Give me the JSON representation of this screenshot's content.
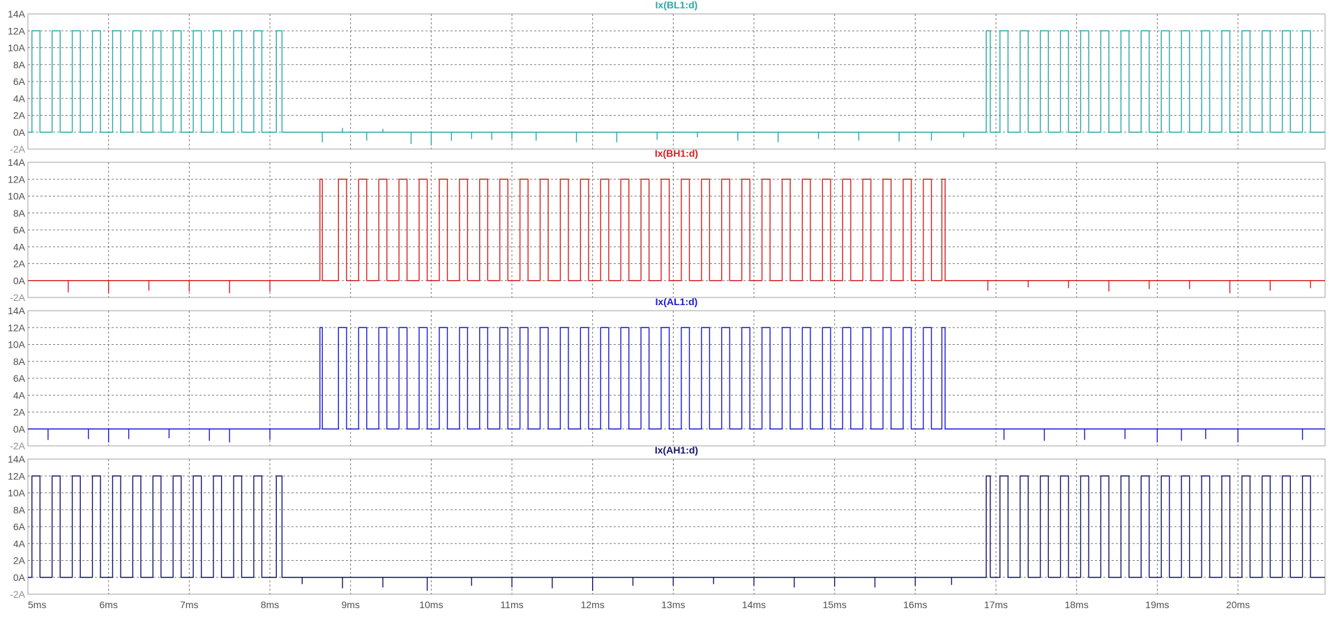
{
  "chart_data": {
    "type": "line",
    "x_unit": "ms",
    "xlim": [
      5,
      21.08
    ],
    "x_ticks": [
      5,
      6,
      7,
      8,
      9,
      10,
      11,
      12,
      13,
      14,
      15,
      16,
      17,
      18,
      19,
      20
    ],
    "x_tick_labels": [
      "5ms",
      "6ms",
      "7ms",
      "8ms",
      "9ms",
      "10ms",
      "11ms",
      "12ms",
      "13ms",
      "14ms",
      "15ms",
      "16ms",
      "17ms",
      "18ms",
      "19ms",
      "20ms"
    ],
    "y_ticks": [
      -2,
      0,
      2,
      4,
      6,
      8,
      10,
      12,
      14
    ],
    "y_tick_labels": [
      "-2A",
      "0A",
      "2A",
      "4A",
      "6A",
      "8A",
      "10A",
      "12A",
      "14A"
    ],
    "ylim": [
      -2,
      14
    ],
    "grid": true,
    "pulse_high": 12,
    "pulse_low": 0,
    "panels": [
      {
        "title": "Ix(BL1:d)",
        "color": "#2aa9a9",
        "pulse_intervals": [
          [
            5.05,
            5.15
          ],
          [
            5.3,
            5.4
          ],
          [
            5.55,
            5.65
          ],
          [
            5.8,
            5.9
          ],
          [
            6.05,
            6.15
          ],
          [
            6.3,
            6.4
          ],
          [
            6.55,
            6.65
          ],
          [
            6.8,
            6.9
          ],
          [
            7.05,
            7.15
          ],
          [
            7.3,
            7.4
          ],
          [
            7.55,
            7.65
          ],
          [
            7.8,
            7.9
          ],
          [
            8.08,
            8.15
          ],
          [
            16.88,
            16.93
          ],
          [
            17.05,
            17.15
          ],
          [
            17.3,
            17.4
          ],
          [
            17.55,
            17.65
          ],
          [
            17.8,
            17.9
          ],
          [
            18.05,
            18.15
          ],
          [
            18.3,
            18.4
          ],
          [
            18.55,
            18.65
          ],
          [
            18.8,
            18.9
          ],
          [
            19.05,
            19.15
          ],
          [
            19.3,
            19.4
          ],
          [
            19.55,
            19.65
          ],
          [
            19.8,
            19.9
          ],
          [
            20.05,
            20.15
          ],
          [
            20.3,
            20.4
          ],
          [
            20.55,
            20.65
          ],
          [
            20.8,
            20.9
          ]
        ],
        "spikes": [
          [
            8.65,
            -1.2
          ],
          [
            8.9,
            0.5
          ],
          [
            9.2,
            -1.0
          ],
          [
            9.4,
            0.4
          ],
          [
            9.75,
            -1.4
          ],
          [
            10.0,
            -1.5
          ],
          [
            10.25,
            -1.0
          ],
          [
            10.5,
            -0.8
          ],
          [
            10.75,
            -0.9
          ],
          [
            11.0,
            -0.8
          ],
          [
            11.3,
            -1.0
          ],
          [
            11.8,
            -1.2
          ],
          [
            12.3,
            -1.2
          ],
          [
            12.8,
            -0.9
          ],
          [
            13.3,
            -0.6
          ],
          [
            13.8,
            -1.0
          ],
          [
            14.3,
            -1.2
          ],
          [
            14.8,
            -0.8
          ],
          [
            15.3,
            -1.0
          ],
          [
            15.8,
            -1.1
          ],
          [
            16.2,
            -1.0
          ],
          [
            16.6,
            -0.6
          ]
        ]
      },
      {
        "title": "Ix(BH1:d)",
        "color": "#d42020",
        "pulse_intervals": [
          [
            8.62,
            8.65
          ],
          [
            8.85,
            8.95
          ],
          [
            9.1,
            9.2
          ],
          [
            9.35,
            9.45
          ],
          [
            9.6,
            9.7
          ],
          [
            9.85,
            9.95
          ],
          [
            10.1,
            10.2
          ],
          [
            10.35,
            10.45
          ],
          [
            10.6,
            10.7
          ],
          [
            10.85,
            10.95
          ],
          [
            11.1,
            11.2
          ],
          [
            11.35,
            11.45
          ],
          [
            11.6,
            11.7
          ],
          [
            11.85,
            11.95
          ],
          [
            12.1,
            12.2
          ],
          [
            12.35,
            12.45
          ],
          [
            12.6,
            12.7
          ],
          [
            12.85,
            12.95
          ],
          [
            13.1,
            13.2
          ],
          [
            13.35,
            13.45
          ],
          [
            13.6,
            13.7
          ],
          [
            13.85,
            13.95
          ],
          [
            14.1,
            14.2
          ],
          [
            14.35,
            14.45
          ],
          [
            14.6,
            14.7
          ],
          [
            14.85,
            14.95
          ],
          [
            15.1,
            15.2
          ],
          [
            15.35,
            15.45
          ],
          [
            15.6,
            15.7
          ],
          [
            15.85,
            15.95
          ],
          [
            16.1,
            16.2
          ],
          [
            16.33,
            16.37
          ]
        ],
        "spikes": [
          [
            5.5,
            -1.4
          ],
          [
            6.0,
            -1.5
          ],
          [
            6.5,
            -1.2
          ],
          [
            7.0,
            -1.3
          ],
          [
            7.5,
            -1.5
          ],
          [
            8.0,
            -1.3
          ],
          [
            16.9,
            -1.2
          ],
          [
            17.4,
            -0.8
          ],
          [
            17.9,
            -0.9
          ],
          [
            18.4,
            -1.3
          ],
          [
            18.9,
            -1.0
          ],
          [
            19.4,
            -1.0
          ],
          [
            19.9,
            -1.5
          ],
          [
            20.4,
            -1.2
          ],
          [
            20.9,
            -0.9
          ]
        ]
      },
      {
        "title": "Ix(AL1:d)",
        "color": "#1a1ad0",
        "pulse_intervals": [
          [
            8.62,
            8.65
          ],
          [
            8.85,
            8.95
          ],
          [
            9.1,
            9.2
          ],
          [
            9.35,
            9.45
          ],
          [
            9.6,
            9.7
          ],
          [
            9.85,
            9.95
          ],
          [
            10.1,
            10.2
          ],
          [
            10.35,
            10.45
          ],
          [
            10.6,
            10.7
          ],
          [
            10.85,
            10.95
          ],
          [
            11.1,
            11.2
          ],
          [
            11.35,
            11.45
          ],
          [
            11.6,
            11.7
          ],
          [
            11.85,
            11.95
          ],
          [
            12.1,
            12.2
          ],
          [
            12.35,
            12.45
          ],
          [
            12.6,
            12.7
          ],
          [
            12.85,
            12.95
          ],
          [
            13.1,
            13.2
          ],
          [
            13.35,
            13.45
          ],
          [
            13.6,
            13.7
          ],
          [
            13.85,
            13.95
          ],
          [
            14.1,
            14.2
          ],
          [
            14.35,
            14.45
          ],
          [
            14.6,
            14.7
          ],
          [
            14.85,
            14.95
          ],
          [
            15.1,
            15.2
          ],
          [
            15.35,
            15.45
          ],
          [
            15.6,
            15.7
          ],
          [
            15.85,
            15.95
          ],
          [
            16.1,
            16.2
          ],
          [
            16.33,
            16.37
          ]
        ],
        "spikes": [
          [
            5.25,
            -1.3
          ],
          [
            5.75,
            -1.2
          ],
          [
            6.0,
            -1.6
          ],
          [
            6.25,
            -1.2
          ],
          [
            6.75,
            -1.1
          ],
          [
            7.25,
            -1.4
          ],
          [
            7.5,
            -1.6
          ],
          [
            8.0,
            -1.3
          ],
          [
            17.1,
            -1.3
          ],
          [
            17.6,
            -1.4
          ],
          [
            18.1,
            -1.3
          ],
          [
            18.6,
            -1.2
          ],
          [
            19.0,
            -1.6
          ],
          [
            19.3,
            -1.4
          ],
          [
            19.6,
            -1.2
          ],
          [
            20.0,
            -1.6
          ],
          [
            20.8,
            -1.3
          ]
        ]
      },
      {
        "title": "Ix(AH1:d)",
        "color": "#141470",
        "pulse_intervals": [
          [
            5.05,
            5.15
          ],
          [
            5.3,
            5.4
          ],
          [
            5.55,
            5.65
          ],
          [
            5.8,
            5.9
          ],
          [
            6.05,
            6.15
          ],
          [
            6.3,
            6.4
          ],
          [
            6.55,
            6.65
          ],
          [
            6.8,
            6.9
          ],
          [
            7.05,
            7.15
          ],
          [
            7.3,
            7.4
          ],
          [
            7.55,
            7.65
          ],
          [
            7.8,
            7.9
          ],
          [
            8.08,
            8.15
          ],
          [
            16.88,
            16.93
          ],
          [
            17.05,
            17.15
          ],
          [
            17.3,
            17.4
          ],
          [
            17.55,
            17.65
          ],
          [
            17.8,
            17.9
          ],
          [
            18.05,
            18.15
          ],
          [
            18.3,
            18.4
          ],
          [
            18.55,
            18.65
          ],
          [
            18.8,
            18.9
          ],
          [
            19.05,
            19.15
          ],
          [
            19.3,
            19.4
          ],
          [
            19.55,
            19.65
          ],
          [
            19.8,
            19.9
          ],
          [
            20.05,
            20.15
          ],
          [
            20.3,
            20.4
          ],
          [
            20.55,
            20.65
          ],
          [
            20.8,
            20.9
          ]
        ],
        "spikes": [
          [
            8.4,
            -0.8
          ],
          [
            8.9,
            -1.3
          ],
          [
            9.4,
            -1.2
          ],
          [
            9.95,
            -1.6
          ],
          [
            10.5,
            -1.0
          ],
          [
            11.0,
            -1.2
          ],
          [
            11.5,
            -1.3
          ],
          [
            12.0,
            -1.6
          ],
          [
            12.5,
            -1.0
          ],
          [
            13.0,
            -1.0
          ],
          [
            13.5,
            -0.8
          ],
          [
            14.0,
            -1.0
          ],
          [
            14.5,
            -1.2
          ],
          [
            15.0,
            -1.1
          ],
          [
            15.5,
            -1.2
          ],
          [
            16.0,
            -1.0
          ],
          [
            16.45,
            -0.9
          ]
        ]
      }
    ]
  }
}
